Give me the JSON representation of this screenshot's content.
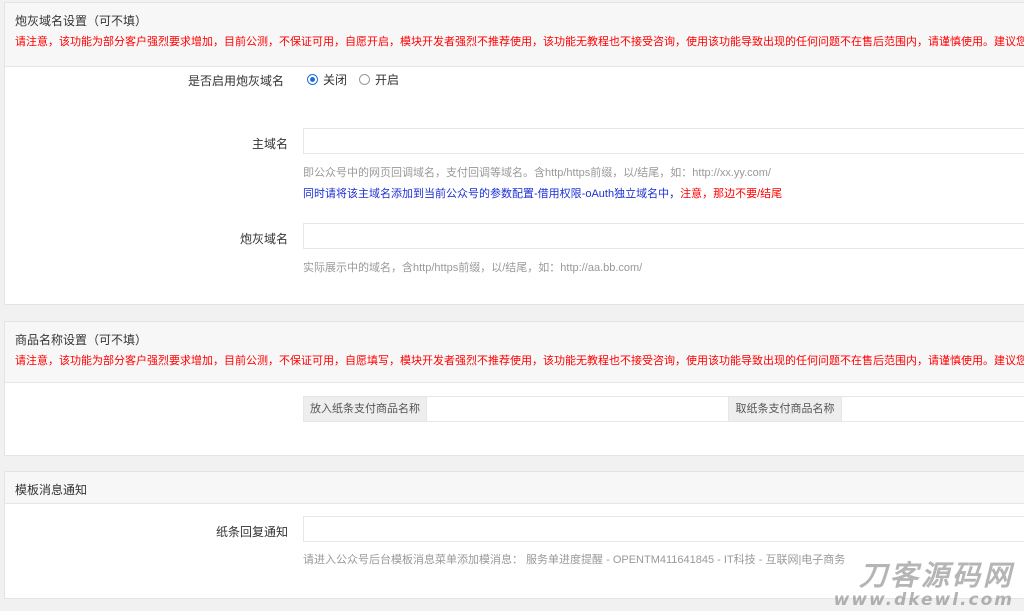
{
  "cannon_domain": {
    "title": "炮灰域名设置（可不填）",
    "warning": "请注意，该功能为部分客户强烈要求增加，目前公测，不保证可用，自愿开启，模块开发者强烈不推荐使用，该功能无教程也不接受咨询，使用该功能导致出现的任何问题不在售后范围内，请谨慎使用。建议您合法合",
    "enable_label": "是否启用炮灰域名",
    "options": [
      "关闭",
      "开启"
    ],
    "selected_option": "关闭",
    "main_domain_label": "主域名",
    "main_domain_value": "",
    "main_domain_help": "即公众号中的网页回调域名，支付回调等域名。含http/https前缀，以/结尾，如：http://xx.yy.com/",
    "main_domain_note_blue": "同时请将该主域名添加到当前公众号的参数配置-借用权限-oAuth独立域名中，",
    "main_domain_note_red": "注意，那边不要/结尾",
    "cannon_label": "炮灰域名",
    "cannon_value": "",
    "cannon_help": "实际展示中的域名，含http/https前缀，以/结尾，如：http://aa.bb.com/"
  },
  "product_name": {
    "title": "商品名称设置（可不填）",
    "warning": "请注意，该功能为部分客户强烈要求增加，目前公测，不保证可用，自愿填写，模块开发者强烈不推荐使用，该功能无教程也不接受咨询，使用该功能导致出现的任何问题不在售后范围内，请谨慎使用。建议您合法合",
    "put_addon": "放入纸条支付商品名称",
    "put_value": "",
    "take_addon": "取纸条支付商品名称",
    "take_value": ""
  },
  "template_msg": {
    "title": "模板消息通知",
    "reply_label": "纸条回复通知",
    "reply_value": "",
    "reply_help": "请进入公众号后台模板消息菜单添加模消息： 服务单进度提醒 - OPENTM411641845 - IT科技 - 互联网|电子商务"
  },
  "watermark": {
    "big": "刀客源码网",
    "small": "www.dkewl.com"
  }
}
